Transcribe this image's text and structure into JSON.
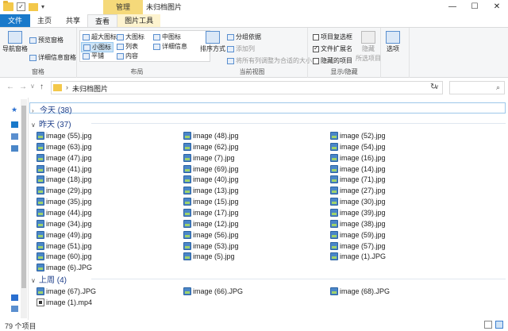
{
  "titlebar": {
    "manage_tab": "管理",
    "title": "未归档图片",
    "controls": [
      "—",
      "☐",
      "✕"
    ]
  },
  "ribbon_tabs": [
    "文件",
    "主页",
    "共享",
    "查看",
    "图片工具"
  ],
  "ribbon": {
    "pane": {
      "nav_pane": "导航窗格",
      "preview": "预览窗格",
      "details": "详细信息窗格",
      "label": "窗格"
    },
    "layout": {
      "extra_large": "超大图标",
      "large": "大图标",
      "medium": "中图标",
      "small": "小图标",
      "list": "列表",
      "details": "详细信息",
      "tiles": "平铺",
      "content": "内容",
      "label": "布局"
    },
    "current_view": {
      "sort_by": "排序方式",
      "group_by": "分组依据",
      "add_columns": "添加列",
      "size_all": "将所有列调整为合适的大小",
      "label": "当前视图"
    },
    "show_hide": {
      "item_checkboxes": "项目复选框",
      "file_extensions": "文件扩展名",
      "hidden_items": "隐藏的项目",
      "hide": "隐藏",
      "hide_selected": "所选项目",
      "label": "显示/隐藏"
    },
    "options": "选项"
  },
  "address": {
    "path": "未归档图片"
  },
  "groups": {
    "today": "今天 (38)",
    "yesterday": "昨天 (37)",
    "lastweek": "上周 (4)"
  },
  "yesterday_files": {
    "col1": [
      "image (55).jpg",
      "image (63).jpg",
      "image (47).jpg",
      "image (41).jpg",
      "image (18).jpg",
      "image (29).jpg",
      "image (35).jpg",
      "image (44).jpg",
      "image (34).jpg",
      "image (49).jpg",
      "image (51).jpg",
      "image (60).jpg",
      "image (6).JPG"
    ],
    "col2": [
      "image (48).jpg",
      "image (62).jpg",
      "image (7).jpg",
      "image (69).jpg",
      "image (40).jpg",
      "image (13).jpg",
      "image (15).jpg",
      "image (17).jpg",
      "image (12).jpg",
      "image (56).jpg",
      "image (53).jpg",
      "image (5).jpg"
    ],
    "col3": [
      "image (52).jpg",
      "image (54).jpg",
      "image (16).jpg",
      "image (14).jpg",
      "image (71).jpg",
      "image (27).jpg",
      "image (30).jpg",
      "image (39).jpg",
      "image (38).jpg",
      "image (59).jpg",
      "image (57).jpg",
      "image (1).JPG"
    ]
  },
  "lastweek_files": [
    "image (67).JPG",
    "image (66).JPG",
    "image (68).JPG",
    "image (1).mp4"
  ],
  "status": {
    "count": "79 个项目"
  }
}
